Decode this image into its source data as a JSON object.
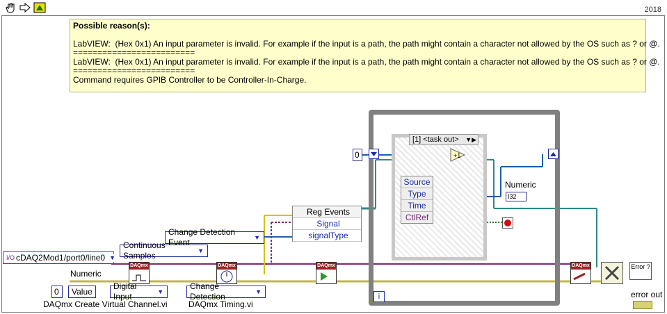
{
  "toolbar": {
    "version": "2018"
  },
  "note": {
    "heading": "Possible reason(s):",
    "lines": [
      "LabVIEW:  (Hex 0x1) An input parameter is invalid. For example if the input is a path, the path might contain a character not allowed by the OS such as ? or @.",
      "=========================",
      "LabVIEW:  (Hex 0x1) An input parameter is invalid. For example if the input is a path, the path might contain a character not allowed by the OS such as ? or @.",
      "=========================",
      "Command requires GPIB Controller to be Controller-In-Charge."
    ]
  },
  "controls": {
    "channel": "cDAQ2Mod1/port0/line0",
    "continuous": "Continuous Samples",
    "change_event": "Change Detection Event",
    "numeric_label": "Numeric",
    "value_zero": "0",
    "value_field": "Value",
    "digital_input": "Digital Input",
    "change_detection": "Change Detection",
    "create_channel_label": "DAQmx Create Virtual Channel.vi",
    "timing_label": "DAQmx Timing.vi",
    "loop_init": "0",
    "numeric2_label": "Numeric",
    "numeric2_type": "I32",
    "error_out": "error out",
    "loop_index": "i"
  },
  "reg_events": {
    "title": "Reg Events",
    "signal": "Signal",
    "signal_type": "signalType"
  },
  "event_case": {
    "header": "[1] <task out>",
    "items": [
      "Source",
      "Type",
      "Time",
      "CtlRef"
    ]
  },
  "vis": {
    "daqmx": "DAQmx",
    "error": "Error ?"
  }
}
